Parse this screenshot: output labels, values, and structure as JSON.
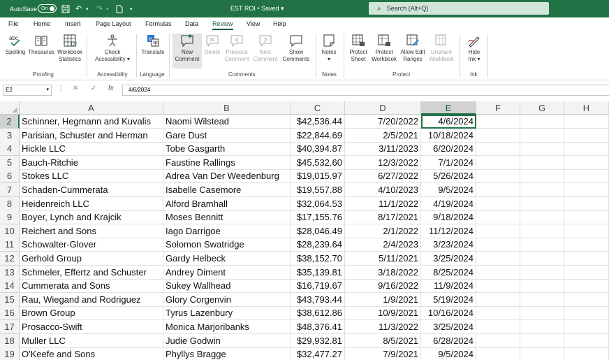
{
  "titlebar": {
    "autosave_label": "AutoSave",
    "autosave_state": "On",
    "title": "EST ROI • Saved ▾",
    "search_placeholder": "Search (Alt+Q)"
  },
  "menu": {
    "tabs": [
      "File",
      "Home",
      "Insert",
      "Page Layout",
      "Formulas",
      "Data",
      "Review",
      "View",
      "Help"
    ],
    "active_tab": "Review"
  },
  "ribbon": {
    "spelling": "Spelling",
    "thesaurus": "Thesaurus",
    "workbook_statistics_1": "Workbook",
    "workbook_statistics_2": "Statistics",
    "check_accessibility_1": "Check",
    "check_accessibility_2": "Accessibility ▾",
    "translate": "Translate",
    "new_comment_1": "New",
    "new_comment_2": "Comment",
    "delete": "Delete",
    "previous_comment_1": "Previous",
    "previous_comment_2": "Comment",
    "next_comment_1": "Next",
    "next_comment_2": "Comment",
    "show_comments_1": "Show",
    "show_comments_2": "Comments",
    "notes": "Notes",
    "notes_dd": "▾",
    "protect_sheet_1": "Protect",
    "protect_sheet_2": "Sheet",
    "protect_workbook_1": "Protect",
    "protect_workbook_2": "Workbook",
    "allow_edit_ranges_1": "Allow Edit",
    "allow_edit_ranges_2": "Ranges",
    "unshare_workbook_1": "Unshare",
    "unshare_workbook_2": "Workbook",
    "hide_ink_1": "Hide",
    "hide_ink_2": "Ink ▾",
    "groups": {
      "proofing": "Proofing",
      "accessibility": "Accessibility",
      "language": "Language",
      "comments": "Comments",
      "notes": "Notes",
      "protect": "Protect",
      "ink": "Ink"
    }
  },
  "formula_bar": {
    "name_box": "E2",
    "fx": "fx",
    "cancel": "✕",
    "enter": "✓",
    "value": "4/6/2024"
  },
  "grid": {
    "columns": [
      "A",
      "B",
      "C",
      "D",
      "E",
      "F",
      "G",
      "H"
    ],
    "selected_cell": "E2",
    "rows": [
      {
        "n": "2",
        "a": "Schinner, Hegmann and Kuvalis",
        "b": "Naomi Wilstead",
        "c": "$42,536.44",
        "d": "7/20/2022",
        "e": "4/6/2024"
      },
      {
        "n": "3",
        "a": "Parisian, Schuster and Herman",
        "b": "Gare Dust",
        "c": "$22,844.69",
        "d": "2/5/2021",
        "e": "10/18/2024"
      },
      {
        "n": "4",
        "a": "Hickle LLC",
        "b": "Tobe Gasgarth",
        "c": "$40,394.87",
        "d": "3/11/2023",
        "e": "6/20/2024"
      },
      {
        "n": "5",
        "a": "Bauch-Ritchie",
        "b": "Faustine Rallings",
        "c": "$45,532.60",
        "d": "12/3/2022",
        "e": "7/1/2024"
      },
      {
        "n": "6",
        "a": "Stokes LLC",
        "b": "Adrea Van Der Weedenburg",
        "c": "$19,015.97",
        "d": "6/27/2022",
        "e": "5/26/2024"
      },
      {
        "n": "7",
        "a": "Schaden-Cummerata",
        "b": "Isabelle Casemore",
        "c": "$19,557.88",
        "d": "4/10/2023",
        "e": "9/5/2024"
      },
      {
        "n": "8",
        "a": "Heidenreich LLC",
        "b": "Alford Bramhall",
        "c": "$32,064.53",
        "d": "11/1/2022",
        "e": "4/19/2024"
      },
      {
        "n": "9",
        "a": "Boyer, Lynch and Krajcik",
        "b": "Moses Bennitt",
        "c": "$17,155.76",
        "d": "8/17/2021",
        "e": "9/18/2024"
      },
      {
        "n": "10",
        "a": "Reichert and Sons",
        "b": "Iago Darrigoe",
        "c": "$28,046.49",
        "d": "2/1/2022",
        "e": "11/12/2024"
      },
      {
        "n": "11",
        "a": "Schowalter-Glover",
        "b": "Solomon Swatridge",
        "c": "$28,239.64",
        "d": "2/4/2023",
        "e": "3/23/2024"
      },
      {
        "n": "12",
        "a": "Gerhold Group",
        "b": "Gardy Helbeck",
        "c": "$38,152.70",
        "d": "5/11/2021",
        "e": "3/25/2024"
      },
      {
        "n": "13",
        "a": "Schmeler, Effertz and Schuster",
        "b": "Andrey Diment",
        "c": "$35,139.81",
        "d": "3/18/2022",
        "e": "8/25/2024"
      },
      {
        "n": "14",
        "a": "Cummerata and Sons",
        "b": "Sukey Wallhead",
        "c": "$16,719.67",
        "d": "9/16/2022",
        "e": "11/9/2024"
      },
      {
        "n": "15",
        "a": "Rau, Wiegand and Rodriguez",
        "b": "Glory Corgenvin",
        "c": "$43,793.44",
        "d": "1/9/2021",
        "e": "5/19/2024"
      },
      {
        "n": "16",
        "a": "Brown Group",
        "b": "Tyrus Lazenbury",
        "c": "$38,612.86",
        "d": "10/9/2021",
        "e": "10/16/2024"
      },
      {
        "n": "17",
        "a": "Prosacco-Swift",
        "b": "Monica Marjoribanks",
        "c": "$48,376.41",
        "d": "11/3/2022",
        "e": "3/25/2024"
      },
      {
        "n": "18",
        "a": "Muller LLC",
        "b": "Judie Godwin",
        "c": "$29,932.81",
        "d": "8/5/2021",
        "e": "6/28/2024"
      },
      {
        "n": "19",
        "a": "O'Keefe and Sons",
        "b": "Phyllys Bragge",
        "c": "$32,477.27",
        "d": "7/9/2021",
        "e": "9/5/2024"
      }
    ]
  },
  "colors": {
    "brand": "#217346",
    "accent": "#185c37"
  }
}
